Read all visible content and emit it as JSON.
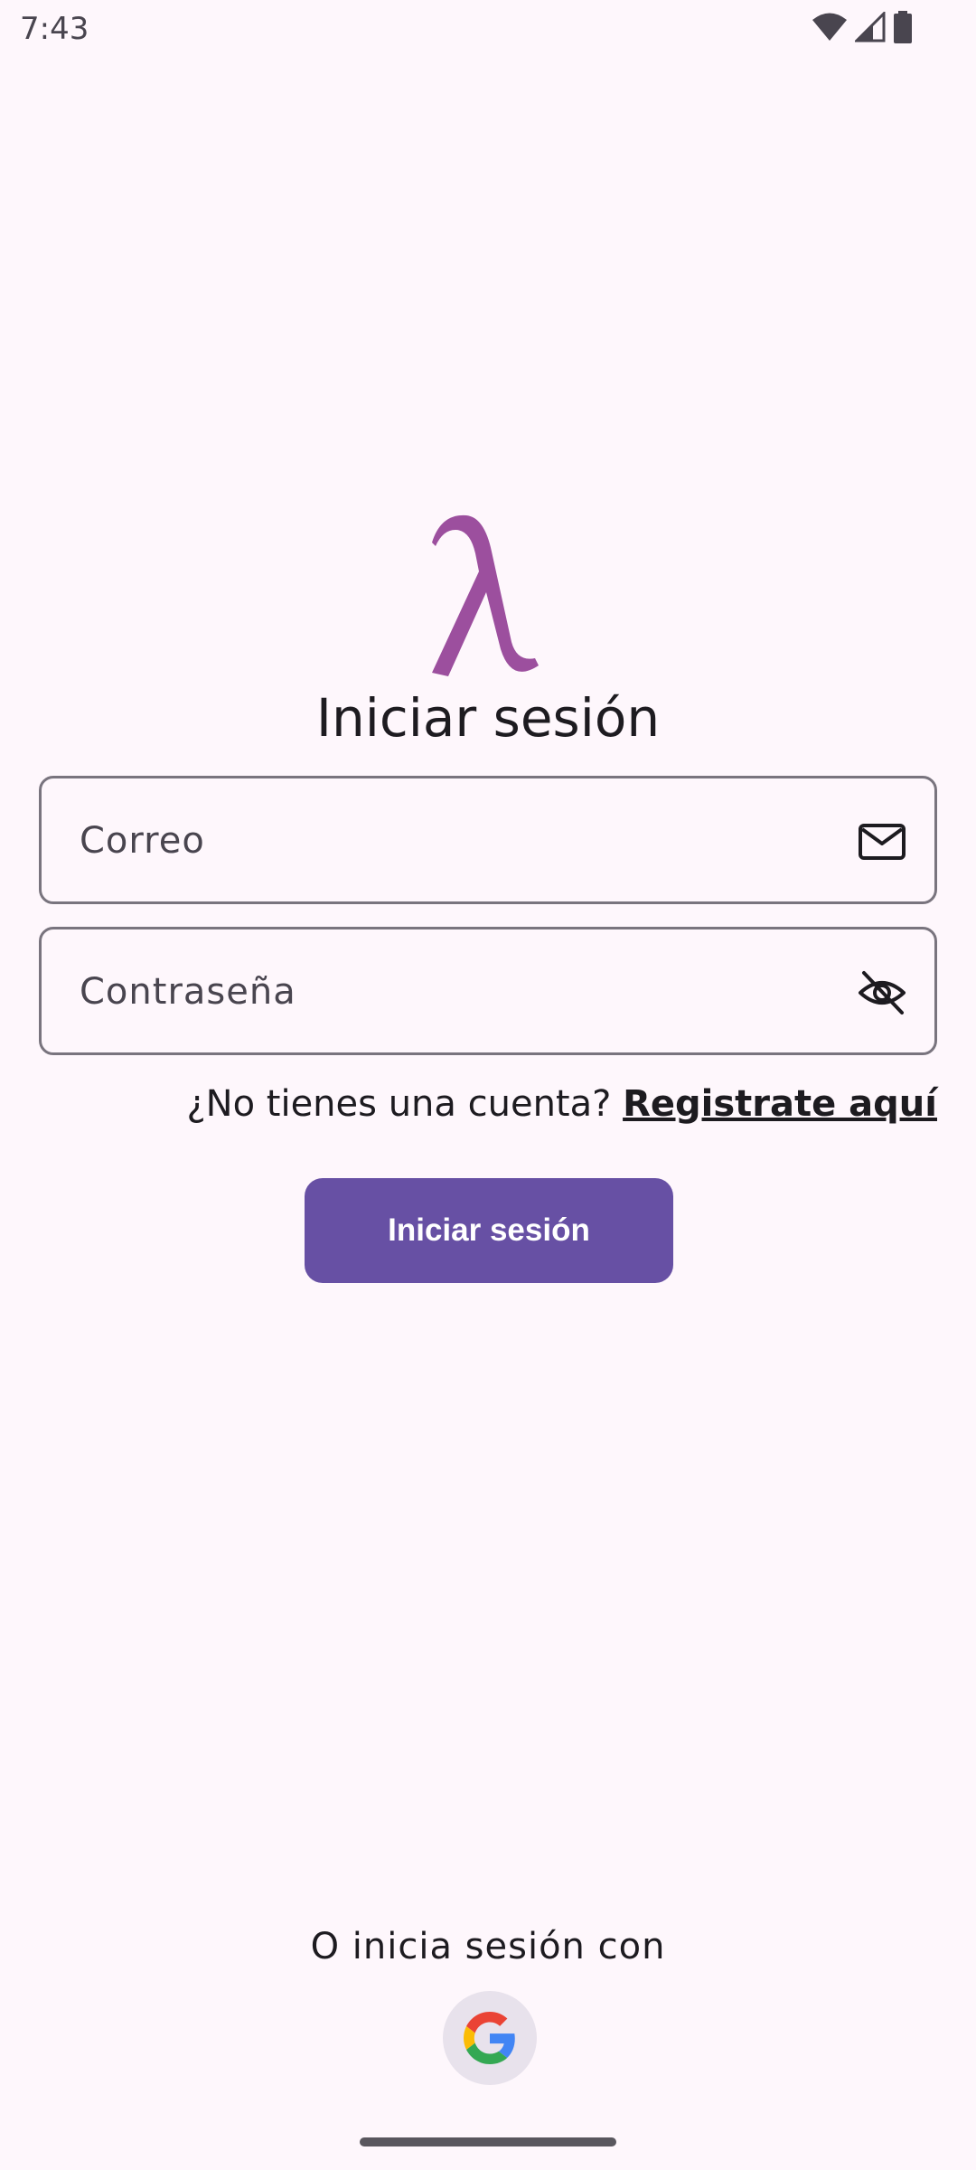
{
  "status_bar": {
    "time": "7:43",
    "icons": [
      "wifi-icon",
      "cell-signal-icon",
      "battery-icon"
    ]
  },
  "logo": {
    "glyph": "λ",
    "color": "#9c4f9e"
  },
  "title": "Iniciar sesión",
  "email_field": {
    "placeholder": "Correo",
    "value": "",
    "icon": "mail-icon"
  },
  "password_field": {
    "placeholder": "Contraseña",
    "value": "",
    "icon": "visibility-off-icon"
  },
  "signup": {
    "prompt": "¿No tienes una cuenta? ",
    "link": "Registrate aquí"
  },
  "login_button": {
    "label": "Iniciar sesión",
    "color": "#6750a4"
  },
  "alternative": {
    "text": "O inicia sesión con",
    "provider_icon": "google-icon"
  }
}
